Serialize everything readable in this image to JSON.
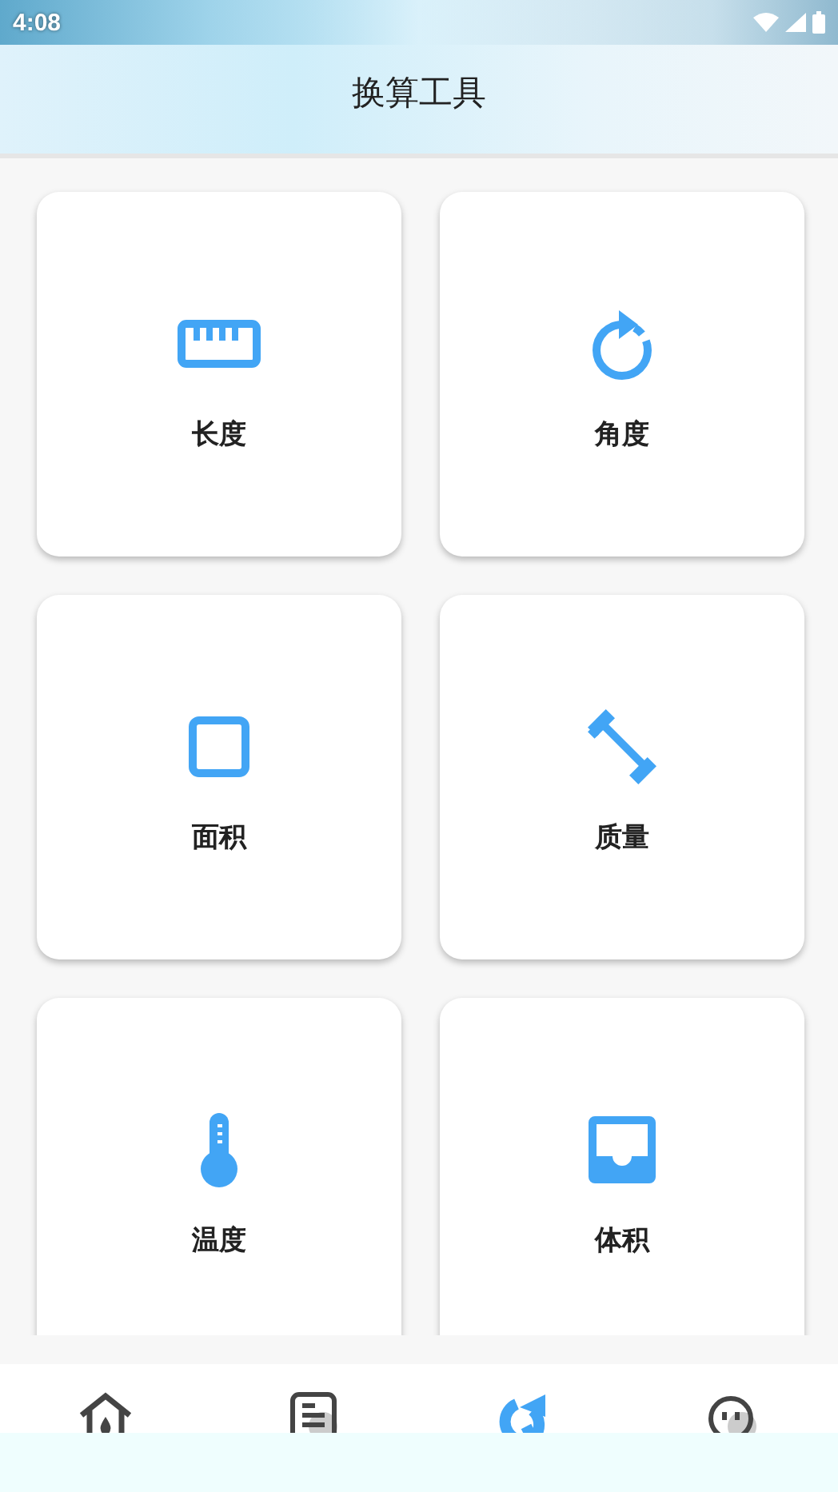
{
  "status_bar": {
    "time": "4:08"
  },
  "header": {
    "title": "换算工具"
  },
  "tools": [
    {
      "kind": "ruler",
      "label": "长度"
    },
    {
      "kind": "rotate",
      "label": "角度"
    },
    {
      "kind": "square",
      "label": "面积"
    },
    {
      "kind": "dumbbell",
      "label": "质量"
    },
    {
      "kind": "thermometer",
      "label": "温度"
    },
    {
      "kind": "inbox",
      "label": "体积"
    }
  ],
  "bottom_nav": [
    {
      "kind": "home",
      "selected": false
    },
    {
      "kind": "document",
      "selected": false
    },
    {
      "kind": "convert",
      "selected": true
    },
    {
      "kind": "face",
      "selected": false
    }
  ]
}
